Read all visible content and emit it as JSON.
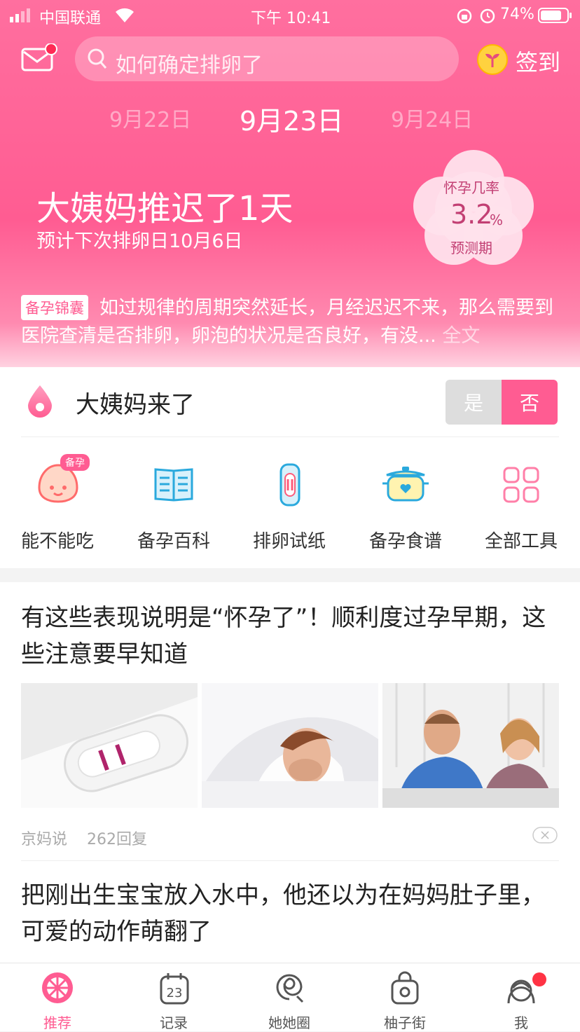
{
  "status_bar": {
    "carrier": "中国联通",
    "time": "下午 10:41",
    "battery": "74%"
  },
  "header": {
    "search_placeholder": "如何确定排卵了",
    "checkin_label": "签到",
    "dates": {
      "prev": "9月22日",
      "current": "9月23日",
      "next": "9月24日"
    },
    "period_status": "大姨妈推迟了1天",
    "next_ovulation": "预计下次排卵日10月6日",
    "pregnancy": {
      "label": "怀孕几率",
      "value": "3.2",
      "unit": "%",
      "phase": "预测期"
    },
    "tip": {
      "badge": "备孕锦囊",
      "text": "如过规律的周期突然延长，月经迟迟不来，那么需要到医院查清是否排卵，卵泡的状况是否良好，有没...",
      "more": "全文"
    }
  },
  "period_question": {
    "label": "大姨妈来了",
    "yes": "是",
    "no": "否",
    "selected": "no"
  },
  "tools": [
    {
      "label": "能不能吃",
      "icon": "food-check-icon",
      "badge": "备孕"
    },
    {
      "label": "备孕百科",
      "icon": "book-icon"
    },
    {
      "label": "排卵试纸",
      "icon": "test-strip-icon"
    },
    {
      "label": "备孕食谱",
      "icon": "pot-icon"
    },
    {
      "label": "全部工具",
      "icon": "grid-icon"
    }
  ],
  "feed": [
    {
      "title": "有这些表现说明是“怀孕了”！顺利度过孕早期，这些注意要早知道",
      "source": "京妈说",
      "replies": "262回复",
      "images": [
        "pregnancy-test-image",
        "nausea-woman-image",
        "couple-image"
      ]
    },
    {
      "title": "把刚出生宝宝放入水中，他还以为在妈妈肚子里，可爱的动作萌翻了"
    }
  ],
  "tabbar": [
    {
      "label": "推荐",
      "icon": "grapefruit-icon",
      "active": true
    },
    {
      "label": "记录",
      "icon": "calendar-23-icon"
    },
    {
      "label": "她她圈",
      "icon": "spiral-icon"
    },
    {
      "label": "柚子街",
      "icon": "shopping-bag-icon"
    },
    {
      "label": "我",
      "icon": "profile-icon"
    }
  ],
  "colors": {
    "brand": "#ff5c92",
    "brand_light": "#ff8ab0",
    "text": "#333333"
  }
}
